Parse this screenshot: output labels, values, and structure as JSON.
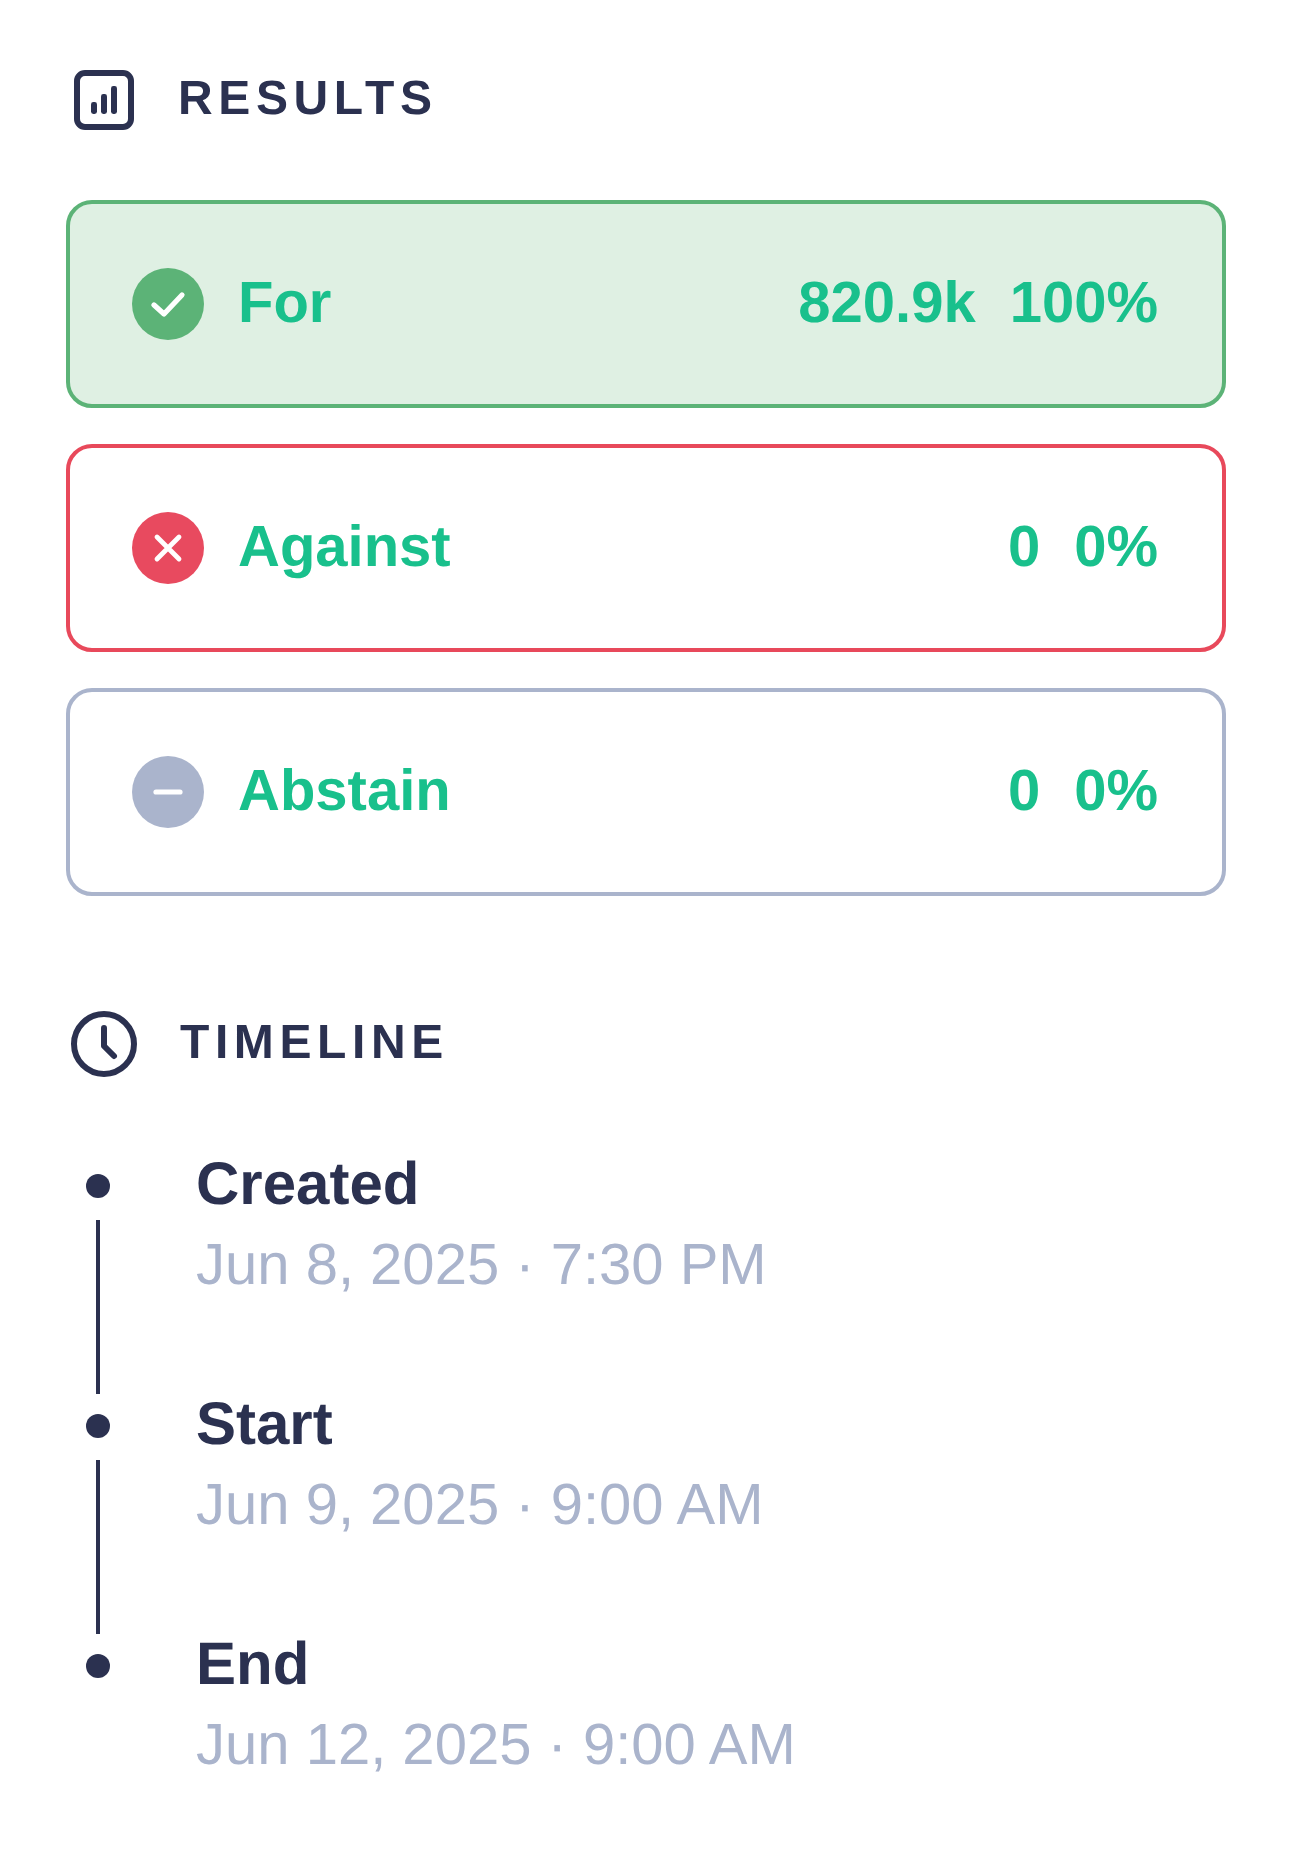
{
  "results": {
    "title": "RESULTS",
    "options": [
      {
        "kind": "for",
        "label": "For",
        "votes": "820.9k",
        "percent": "100%",
        "selected": true
      },
      {
        "kind": "against",
        "label": "Against",
        "votes": "0",
        "percent": "0%",
        "selected": false
      },
      {
        "kind": "abstain",
        "label": "Abstain",
        "votes": "0",
        "percent": "0%",
        "selected": false
      }
    ]
  },
  "timeline": {
    "title": "TIMELINE",
    "events": [
      {
        "label": "Created",
        "date": "Jun 8, 2025 · 7:30 PM"
      },
      {
        "label": "Start",
        "date": "Jun 9, 2025 · 9:00 AM"
      },
      {
        "label": "End",
        "date": "Jun 12, 2025 · 9:00 AM"
      }
    ]
  }
}
